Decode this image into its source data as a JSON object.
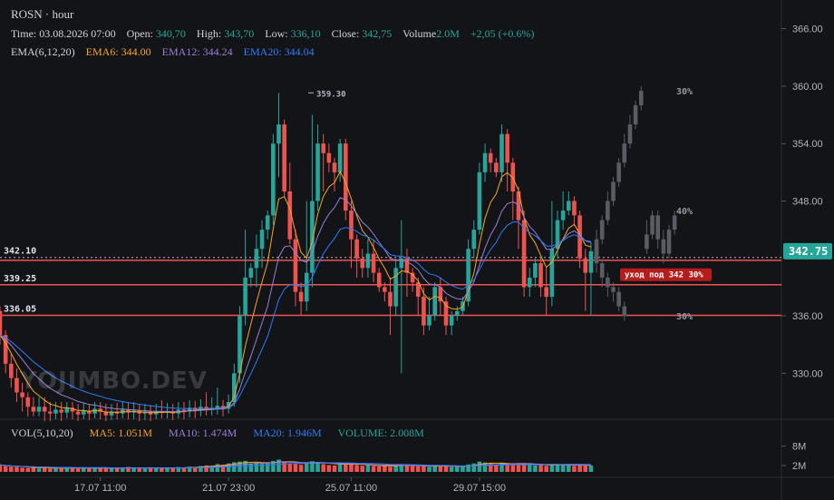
{
  "header": {
    "symbol": "ROSN · hour",
    "time_label": "Time:",
    "time_value": "03.08.2026 07:00",
    "open_label": "Open:",
    "open_value": "340,70",
    "high_label": "High:",
    "high_value": "343,70",
    "low_label": "Low:",
    "low_value": "336,10",
    "close_label": "Close:",
    "close_value": "342,75",
    "volume_label": "Volume",
    "volume_value": "2.0M",
    "change_value": "+2,05 (+0.6%)",
    "ema_label": "EMA(6,12,20)",
    "ema6": "EMA6: 344.00",
    "ema12": "EMA12: 344.24",
    "ema20": "EMA20: 344.04"
  },
  "volume_header": {
    "label": "VOL(5,10,20)",
    "ma5": "MA5: 1.051M",
    "ma10": "MA10: 1.474M",
    "ma20": "MA20: 1.946M",
    "volume": "VOLUME: 2.008M"
  },
  "watermark": "YOJIMBO.DEV",
  "colors": {
    "up": "#26a69a",
    "down": "#ef5350",
    "ema6": "#f5a623",
    "ema12": "#9b7fd4",
    "ema20": "#2f7cf6",
    "level": "#ef5350",
    "price_tag": "#26a69a",
    "forecast": "#5a5c63"
  },
  "levels": [
    {
      "value": 342.1,
      "label": "342.10",
      "style": "dotted"
    },
    {
      "value": 341.8,
      "label": "",
      "style": "solid"
    },
    {
      "value": 339.25,
      "label": "339.25",
      "style": "solid"
    },
    {
      "value": 336.05,
      "label": "336.05",
      "style": "solid"
    }
  ],
  "current_price": "342.75",
  "annotations": {
    "high_marker": "359.30",
    "tag": "уход под 342 30%",
    "p30_top": "30%",
    "p40": "40%",
    "p30_bottom": "30%"
  },
  "chart_data": {
    "type": "candlestick",
    "y_ticks": [
      "366.00",
      "360.00",
      "354.00",
      "348.00",
      "336.00",
      "330.00"
    ],
    "y_tick_values": [
      366,
      360,
      354,
      348,
      336,
      330
    ],
    "ylim": [
      325.2,
      369
    ],
    "volume_ticks": [
      "8M",
      "2M"
    ],
    "volume_tick_values": [
      8,
      2
    ],
    "x_ticks": [
      "17.07 11:00",
      "21.07 23:00",
      "25.07 11:00",
      "29.07 15:00"
    ],
    "x_tick_index": [
      18,
      41,
      63,
      86
    ],
    "candles": [
      [
        336.5,
        334.0,
        337.0,
        333.0
      ],
      [
        334.0,
        331.0,
        334.5,
        330.0
      ],
      [
        331.0,
        329.5,
        332.0,
        328.5
      ],
      [
        329.5,
        328.0,
        330.5,
        327.0
      ],
      [
        328.0,
        327.5,
        329.0,
        326.0
      ],
      [
        327.5,
        326.5,
        328.0,
        325.5
      ],
      [
        326.5,
        326.0,
        327.5,
        325.5
      ],
      [
        326.0,
        326.5,
        327.5,
        325.5
      ],
      [
        326.5,
        326.0,
        327.5,
        325.0
      ],
      [
        326.0,
        325.8,
        327.0,
        325.0
      ],
      [
        325.8,
        326.2,
        327.0,
        325.2
      ],
      [
        326.2,
        325.9,
        327.0,
        325.0
      ],
      [
        325.9,
        326.4,
        327.0,
        325.3
      ],
      [
        326.4,
        326.0,
        327.0,
        325.2
      ],
      [
        326.0,
        325.7,
        326.8,
        325.0
      ],
      [
        325.7,
        326.1,
        326.9,
        325.2
      ],
      [
        326.1,
        325.8,
        326.8,
        325.1
      ],
      [
        325.8,
        326.3,
        327.0,
        325.3
      ],
      [
        326.3,
        326.0,
        327.0,
        325.2
      ],
      [
        326.0,
        325.6,
        326.8,
        325.0
      ],
      [
        325.6,
        326.0,
        326.8,
        325.1
      ],
      [
        326.0,
        325.8,
        326.9,
        325.2
      ],
      [
        325.8,
        326.2,
        327.0,
        325.3
      ],
      [
        326.2,
        325.9,
        327.0,
        325.2
      ],
      [
        325.9,
        326.1,
        327.0,
        325.2
      ],
      [
        326.1,
        325.8,
        326.8,
        325.0
      ],
      [
        325.8,
        326.0,
        326.8,
        325.1
      ],
      [
        326.0,
        325.7,
        326.7,
        325.0
      ],
      [
        325.7,
        326.0,
        326.8,
        325.2
      ],
      [
        326.0,
        325.9,
        327.2,
        325.3
      ],
      [
        325.9,
        326.0,
        326.9,
        325.3
      ],
      [
        326.0,
        325.8,
        326.8,
        325.1
      ],
      [
        325.8,
        326.2,
        327.0,
        325.3
      ],
      [
        326.2,
        326.0,
        327.0,
        325.2
      ],
      [
        326.0,
        326.4,
        327.2,
        325.4
      ],
      [
        326.4,
        326.1,
        327.1,
        325.3
      ],
      [
        326.1,
        326.5,
        327.3,
        325.5
      ],
      [
        326.5,
        326.3,
        328.0,
        325.6
      ],
      [
        326.3,
        326.4,
        327.5,
        325.6
      ],
      [
        326.4,
        326.6,
        328.5,
        325.7
      ],
      [
        326.6,
        326.3,
        327.2,
        325.5
      ],
      [
        326.3,
        327.0,
        327.8,
        325.8
      ],
      [
        327.0,
        330.0,
        331.0,
        326.5
      ],
      [
        330.0,
        336.0,
        337.0,
        329.0
      ],
      [
        336.0,
        340.0,
        345.0,
        335.0
      ],
      [
        340.0,
        341.0,
        341.5,
        339.0
      ],
      [
        341.0,
        343.0,
        344.5,
        339.0
      ],
      [
        343.0,
        345.0,
        346.0,
        341.0
      ],
      [
        345.0,
        346.5,
        347.0,
        344.0
      ],
      [
        346.5,
        354.0,
        355.0,
        345.5
      ],
      [
        354.0,
        356.0,
        359.3,
        350.5
      ],
      [
        356.0,
        349.0,
        356.5,
        348.5
      ],
      [
        349.0,
        344.0,
        352.0,
        343.5
      ],
      [
        344.0,
        338.5,
        345.0,
        337.0
      ],
      [
        338.5,
        337.5,
        339.5,
        336.0
      ],
      [
        337.5,
        340.5,
        348.0,
        336.5
      ],
      [
        340.5,
        348.0,
        357.0,
        339.0
      ],
      [
        348.0,
        354.0,
        356.0,
        347.0
      ],
      [
        354.0,
        353.0,
        355.0,
        349.0
      ],
      [
        353.0,
        352.0,
        354.0,
        351.0
      ],
      [
        352.0,
        351.0,
        352.5,
        349.0
      ],
      [
        351.0,
        354.0,
        354.5,
        350.0
      ],
      [
        354.0,
        347.0,
        354.5,
        346.0
      ],
      [
        347.0,
        344.0,
        348.0,
        341.0
      ],
      [
        344.0,
        342.0,
        344.5,
        340.0
      ],
      [
        342.0,
        341.0,
        343.0,
        340.0
      ],
      [
        341.0,
        342.5,
        344.0,
        340.0
      ],
      [
        342.5,
        340.5,
        344.0,
        339.5
      ],
      [
        340.5,
        339.0,
        341.0,
        338.5
      ],
      [
        339.0,
        338.5,
        339.5,
        337.5
      ],
      [
        338.5,
        337.0,
        340.0,
        334.0
      ],
      [
        337.0,
        341.0,
        342.0,
        336.0
      ],
      [
        341.0,
        342.0,
        346.0,
        330.0
      ],
      [
        342.0,
        340.5,
        343.0,
        338.0
      ],
      [
        340.5,
        339.5,
        341.0,
        338.5
      ],
      [
        339.5,
        338.0,
        340.0,
        336.0
      ],
      [
        338.0,
        335.0,
        339.0,
        334.0
      ],
      [
        335.0,
        336.0,
        338.0,
        334.5
      ],
      [
        336.0,
        339.0,
        339.5,
        335.5
      ],
      [
        339.0,
        337.5,
        340.0,
        336.0
      ],
      [
        337.5,
        335.0,
        338.0,
        334.0
      ],
      [
        335.0,
        336.0,
        336.5,
        334.0
      ],
      [
        336.0,
        336.5,
        337.0,
        335.5
      ],
      [
        336.5,
        337.5,
        338.0,
        336.0
      ],
      [
        337.5,
        343.0,
        344.0,
        337.0
      ],
      [
        343.0,
        345.0,
        346.0,
        342.0
      ],
      [
        345.0,
        351.0,
        352.0,
        344.5
      ],
      [
        351.0,
        353.0,
        354.0,
        350.0
      ],
      [
        353.0,
        352.0,
        353.5,
        351.0
      ],
      [
        352.0,
        351.0,
        352.5,
        350.5
      ],
      [
        351.0,
        355.0,
        356.0,
        350.0
      ],
      [
        355.0,
        352.0,
        355.5,
        349.0
      ],
      [
        352.0,
        349.0,
        352.5,
        346.0
      ],
      [
        349.0,
        346.0,
        349.5,
        343.0
      ],
      [
        346.0,
        339.0,
        347.0,
        338.0
      ],
      [
        339.0,
        340.0,
        341.0,
        338.0
      ],
      [
        340.0,
        341.5,
        342.0,
        339.0
      ],
      [
        341.5,
        339.0,
        342.0,
        338.0
      ],
      [
        339.0,
        338.0,
        341.0,
        336.0
      ],
      [
        338.0,
        343.0,
        348.0,
        337.0
      ],
      [
        343.0,
        346.0,
        347.0,
        342.0
      ],
      [
        346.0,
        347.0,
        349.0,
        345.0
      ],
      [
        347.0,
        348.0,
        349.0,
        346.5
      ],
      [
        348.0,
        346.5,
        348.5,
        345.5
      ],
      [
        346.5,
        342.0,
        347.0,
        341.0
      ],
      [
        342.0,
        340.5,
        343.0,
        336.5
      ],
      [
        340.5,
        342.75,
        343.7,
        336.1
      ]
    ],
    "volumes": [
      2.2,
      1.8,
      1.6,
      1.5,
      1.3,
      1.2,
      1.4,
      1.1,
      1.3,
      1.0,
      1.2,
      1.1,
      1.4,
      1.2,
      1.0,
      1.3,
      1.1,
      1.2,
      1.0,
      1.4,
      1.3,
      1.2,
      1.1,
      1.5,
      1.2,
      1.3,
      1.0,
      1.4,
      1.2,
      1.1,
      1.3,
      1.2,
      1.5,
      1.3,
      1.6,
      1.4,
      1.8,
      2.0,
      1.9,
      2.4,
      2.1,
      2.6,
      3.0,
      3.2,
      3.4,
      2.6,
      2.8,
      2.5,
      2.9,
      3.4,
      3.8,
      3.0,
      2.7,
      2.5,
      2.2,
      2.8,
      3.3,
      2.9,
      2.4,
      2.1,
      2.0,
      2.6,
      2.8,
      2.3,
      2.1,
      1.9,
      2.2,
      1.8,
      1.7,
      1.9,
      1.6,
      2.1,
      2.4,
      2.0,
      1.8,
      1.7,
      1.9,
      1.6,
      1.8,
      2.0,
      1.7,
      1.5,
      1.6,
      1.8,
      2.3,
      2.6,
      3.2,
      2.9,
      2.5,
      2.2,
      2.8,
      2.7,
      2.4,
      2.3,
      2.6,
      2.1,
      2.0,
      2.2,
      1.9,
      2.4,
      2.3,
      2.1,
      2.0,
      1.9,
      2.2,
      1.9,
      2.0
    ],
    "forecast": [
      [
        343.0,
        341.5,
        344.0,
        340.5
      ],
      [
        341.5,
        340.0,
        342.0,
        339.0
      ],
      [
        340.0,
        339.0,
        340.5,
        338.0
      ],
      [
        339.0,
        338.5,
        339.5,
        337.5
      ],
      [
        338.5,
        337.0,
        339.0,
        336.5
      ],
      [
        337.0,
        336.0,
        337.5,
        335.5
      ],
      [
        342.0,
        344.0,
        345.0,
        341.5
      ],
      [
        344.0,
        346.0,
        346.5,
        343.5
      ],
      [
        346.0,
        348.0,
        349.0,
        345.5
      ],
      [
        348.0,
        350.0,
        350.5,
        347.5
      ],
      [
        350.0,
        352.0,
        352.5,
        349.5
      ],
      [
        352.0,
        354.0,
        355.0,
        351.5
      ],
      [
        354.0,
        356.0,
        357.0,
        353.5
      ],
      [
        356.0,
        358.0,
        358.5,
        355.5
      ],
      [
        358.0,
        359.5,
        360.0,
        357.5
      ],
      [
        343.0,
        344.5,
        346.0,
        342.5
      ],
      [
        344.5,
        346.5,
        347.0,
        344.0
      ],
      [
        346.5,
        344.0,
        347.0,
        343.0
      ],
      [
        344.0,
        342.5,
        345.0,
        341.5
      ],
      [
        342.5,
        345.0,
        345.5,
        342.0
      ],
      [
        345.0,
        346.5,
        347.0,
        344.5
      ]
    ]
  }
}
